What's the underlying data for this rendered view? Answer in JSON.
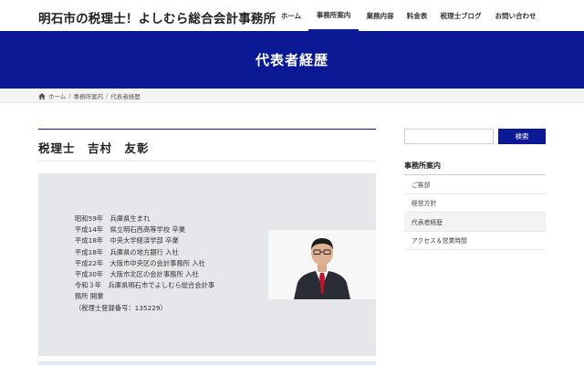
{
  "header": {
    "site_title": "明石市の税理士！よしむら総合会計事務所",
    "nav": [
      {
        "label": "ホーム",
        "name": "nav-home"
      },
      {
        "label": "事務所案内",
        "name": "nav-office"
      },
      {
        "label": "業務内容",
        "name": "nav-services"
      },
      {
        "label": "料金表",
        "name": "nav-fees"
      },
      {
        "label": "税理士ブログ",
        "name": "nav-blog"
      },
      {
        "label": "お問い合わせ",
        "name": "nav-contact"
      }
    ],
    "active_nav": "事務所案内"
  },
  "hero": {
    "title": "代表者経歴"
  },
  "breadcrumb": {
    "home": "ホーム",
    "office": "事務所案内",
    "current": "代表者経歴"
  },
  "main": {
    "heading": "税理士　吉村　友彰",
    "bio_lines": [
      "昭和59年　兵庫県生まれ",
      "平成14年　県立明石西高等学校 卒業",
      "平成18年　中央大学経済学部 卒業",
      "平成18年　兵庫県の地方銀行 入社",
      "平成22年　大阪市中央区の会計事務所 入社",
      "平成30年　大阪市北区の会計事務所 入社",
      "令和３年　兵庫県明石市でよしむら総合会計事",
      "務所 開業",
      "（税理士登録番号：135229）"
    ]
  },
  "sidebar": {
    "search_placeholder": "",
    "search_button": "検索",
    "title": "事務所案内",
    "items": [
      "ご挨拶",
      "経営方針",
      "代表者経歴",
      "アクセス＆営業時間"
    ],
    "current_item": "代表者経歴"
  },
  "colors": {
    "brand_navy": "#0b1a94",
    "bio_background": "#e5e7ea"
  }
}
